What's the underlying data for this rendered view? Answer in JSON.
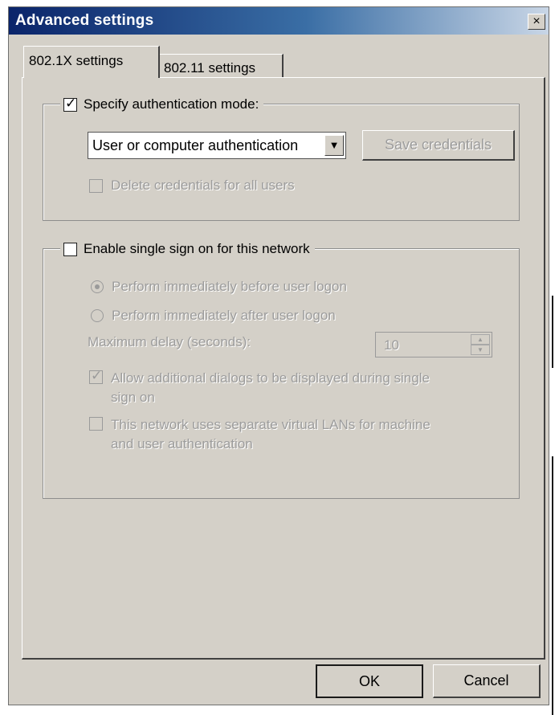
{
  "window": {
    "title": "Advanced settings",
    "close_glyph": "×"
  },
  "tabs": [
    {
      "label": "802.1X settings",
      "active": true
    },
    {
      "label": "802.11 settings",
      "active": false
    }
  ],
  "auth_group": {
    "checkbox_label": "Specify authentication mode:",
    "checked": true,
    "mode_select": {
      "value": "User or computer authentication"
    },
    "save_credentials_label": "Save credentials",
    "delete_credentials_label": "Delete credentials for all users"
  },
  "sso_group": {
    "checkbox_label": "Enable single sign on for this network",
    "checked": false,
    "radio_before_label": "Perform immediately before user logon",
    "radio_after_label": "Perform immediately after user logon",
    "max_delay_label": "Maximum delay (seconds):",
    "max_delay_value": "10",
    "allow_dialogs_label_line1": "Allow additional dialogs to be displayed during single",
    "allow_dialogs_label_line2": "sign on",
    "vlan_label_line1": "This network uses separate virtual LANs for machine",
    "vlan_label_line2": "and user authentication"
  },
  "footer": {
    "ok_label": "OK",
    "cancel_label": "Cancel"
  },
  "colors": {
    "dialog_bg": "#d4d0c8",
    "titlebar": "#0a246a",
    "disabled_text": "#9c9c9c"
  },
  "icons": {
    "checkmark": "check-icon",
    "dropdown": "chevron-down-icon",
    "close": "close-icon"
  }
}
